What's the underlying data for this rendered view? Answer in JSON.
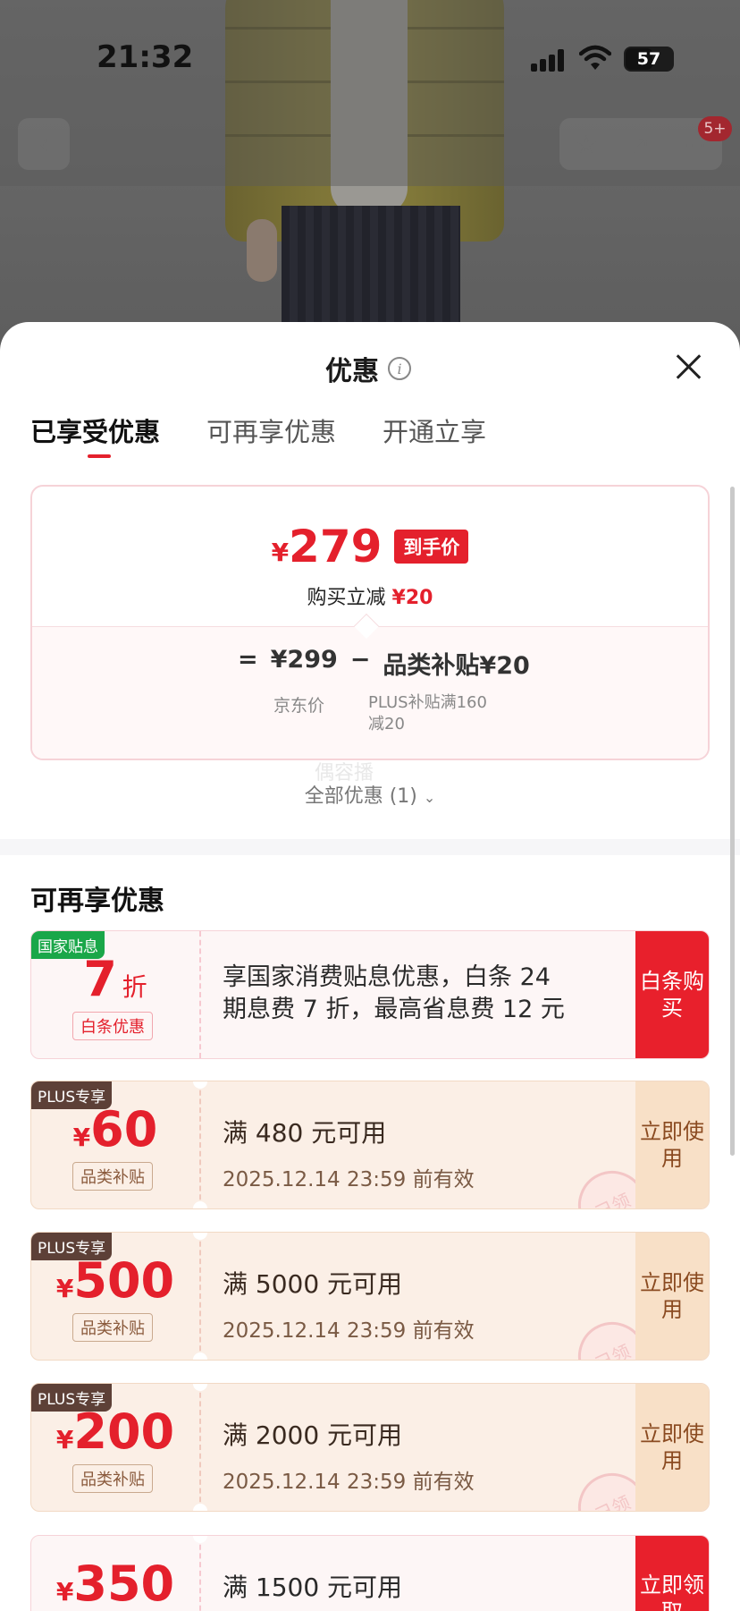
{
  "status": {
    "time": "21:32",
    "battery": "57"
  },
  "nav": {
    "back_icon": "chevron-left-icon",
    "cart_badge": "5+"
  },
  "sheet": {
    "title": "优惠",
    "tabs": [
      {
        "label": "已享受优惠",
        "active": true
      },
      {
        "label": "可再享优惠",
        "active": false
      },
      {
        "label": "开通立享",
        "active": false
      }
    ],
    "price": {
      "currency": "¥",
      "final": "279",
      "final_tag": "到手价",
      "reduce_label": "购买立减",
      "reduce_amount": "¥20",
      "eq": "=",
      "original": "¥299",
      "minus": "−",
      "subsidy": "品类补贴¥20",
      "original_label": "京东价",
      "subsidy_label": "PLUS补贴满160减20"
    },
    "watermark": "偶容播",
    "all_offers": "全部优惠 (1)",
    "section_title": "可再享优惠",
    "coupons": [
      {
        "tag": "国家贴息",
        "amount": "7",
        "suffix": "折",
        "sub": "白条优惠",
        "desc": "享国家消费贴息优惠，白条 24 期息费 7 折，最高省息费 12 元",
        "action": "白条购买"
      },
      {
        "tag": "PLUS专享",
        "yen": "¥",
        "amount": "60",
        "sub": "品类补贴",
        "cond": "满 480 元可用",
        "date": "2025.12.14 23:59 前有效",
        "action": "立即使用",
        "stamp": "已领"
      },
      {
        "tag": "PLUS专享",
        "yen": "¥",
        "amount": "500",
        "sub": "品类补贴",
        "cond": "满 5000 元可用",
        "date": "2025.12.14 23:59 前有效",
        "action": "立即使用",
        "stamp": "已领"
      },
      {
        "tag": "PLUS专享",
        "yen": "¥",
        "amount": "200",
        "sub": "品类补贴",
        "cond": "满 2000 元可用",
        "date": "2025.12.14 23:59 前有效",
        "action": "立即使用",
        "stamp": "已领"
      },
      {
        "yen": "¥",
        "amount": "350",
        "cond": "满 1500 元可用",
        "action": "立即领取"
      }
    ]
  },
  "colors": {
    "accent": "#e4202c",
    "plus_brown": "#5d4037",
    "national_green": "#1aa749"
  }
}
